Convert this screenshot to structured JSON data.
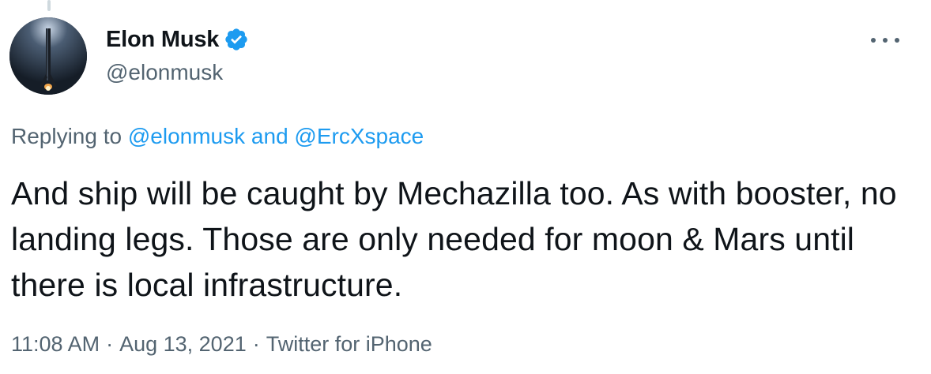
{
  "tweet": {
    "author": {
      "display_name": "Elon Musk",
      "handle": "@elonmusk",
      "verified": true,
      "verified_icon": "verified-badge-icon",
      "avatar_icon": "rocket-booster-avatar"
    },
    "more_icon": "more-dots-icon",
    "replying": {
      "prefix": "Replying to",
      "mentions": [
        "@elonmusk",
        "@ErcXspace"
      ],
      "joiner": "and"
    },
    "text": "And ship will be caught by Mechazilla too. As with booster, no landing legs. Those are only needed for moon & Mars until there is local infrastructure.",
    "meta": {
      "time": "11:08 AM",
      "separator": "·",
      "date": "Aug 13, 2021",
      "source": "Twitter for iPhone"
    }
  },
  "colors": {
    "text": "#0f1419",
    "secondary": "#536471",
    "link": "#1d9bf0",
    "verified": "#1d9bf0"
  }
}
